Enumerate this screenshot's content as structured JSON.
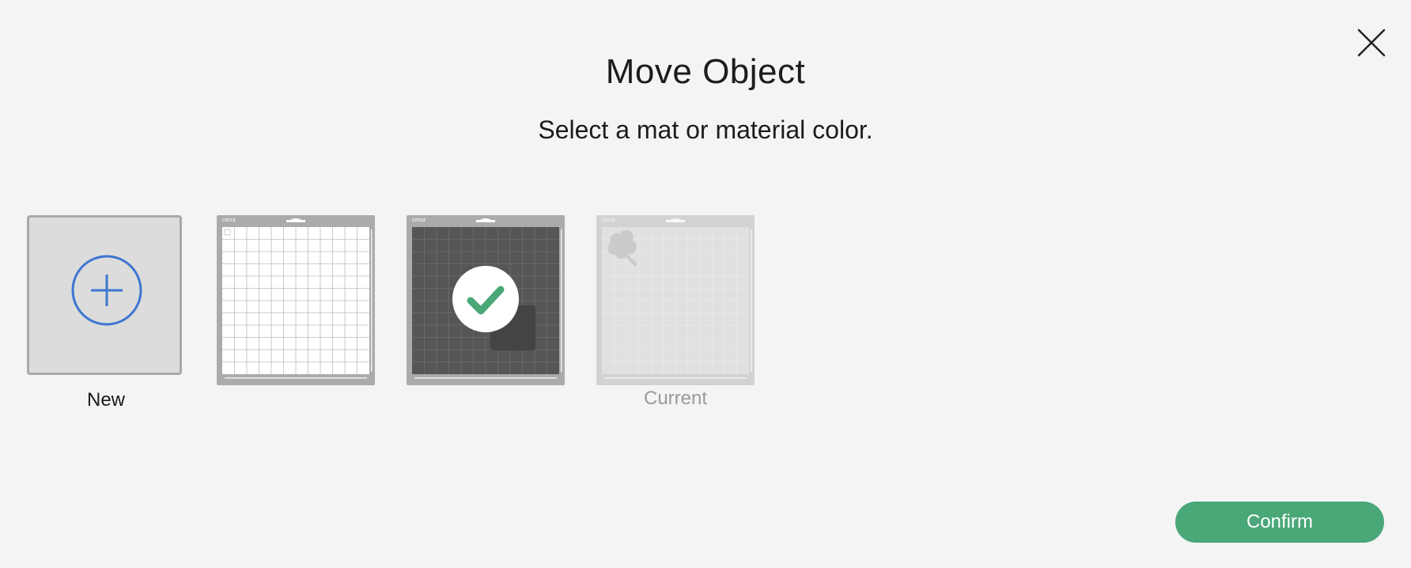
{
  "dialog": {
    "title": "Move Object",
    "subtitle": "Select a mat or material color."
  },
  "close": {
    "icon": "close-icon"
  },
  "options": [
    {
      "id": "new",
      "label": "New",
      "icon": "plus-circle-icon",
      "accent": "#3f76d1"
    },
    {
      "id": "white-mat",
      "label": "",
      "mat_color": "#ffffff",
      "brand": "cricut"
    },
    {
      "id": "dark-mat",
      "label": "",
      "mat_color": "#565656",
      "brand": "cricut",
      "selected": true,
      "check_color": "#4aa778"
    },
    {
      "id": "current-mat",
      "label": "Current",
      "mat_color": "#c6c6c6",
      "brand": "cricut",
      "disabled": true
    }
  ],
  "footer": {
    "confirm_label": "Confirm",
    "confirm_color": "#4aa778"
  }
}
